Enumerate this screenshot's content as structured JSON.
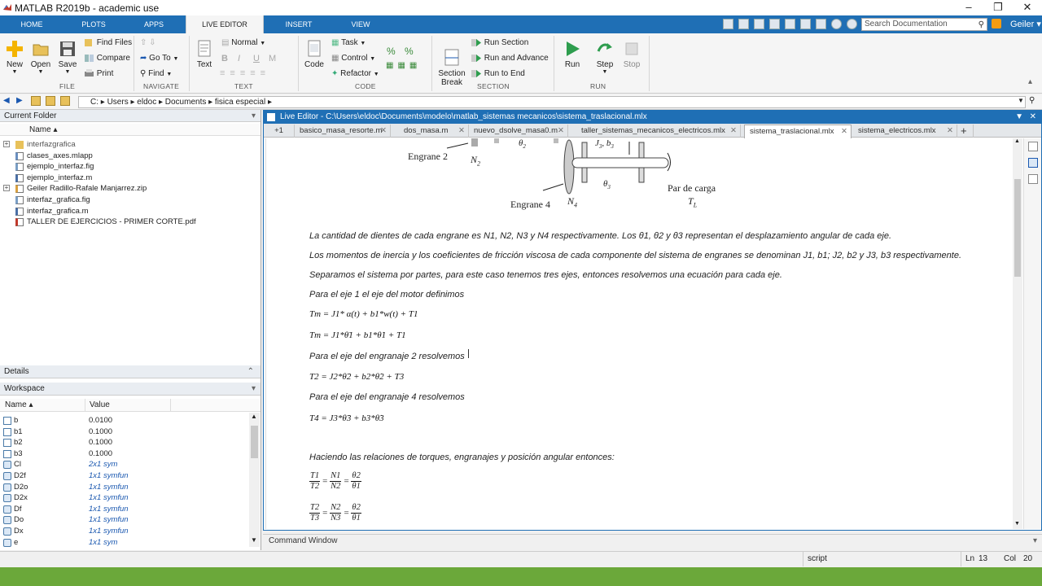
{
  "window": {
    "title": "MATLAB R2019b - academic use",
    "buttons": [
      "–",
      "❐",
      "✕"
    ]
  },
  "ribbon_tabs": [
    {
      "label": "HOME",
      "active": false
    },
    {
      "label": "PLOTS",
      "active": false
    },
    {
      "label": "APPS",
      "active": false
    },
    {
      "label": "LIVE EDITOR",
      "active": true
    },
    {
      "label": "INSERT",
      "active": false
    },
    {
      "label": "VIEW",
      "active": false
    }
  ],
  "search": {
    "placeholder": "Search Documentation"
  },
  "user": {
    "name": "Geiler ▾"
  },
  "ribbon": {
    "file": {
      "new": "New",
      "open": "Open",
      "save": "Save",
      "find_files": "Find Files",
      "compare": "Compare",
      "print": "Print",
      "group": "FILE"
    },
    "navigate": {
      "goto": "Go To",
      "find": "Find",
      "group": "NAVIGATE"
    },
    "text": {
      "text_btn": "Text",
      "style": "Normal",
      "bold": "B",
      "italic": "I",
      "underline": "U",
      "mono": "M",
      "group": "TEXT"
    },
    "code": {
      "code_btn": "Code",
      "task": "Task",
      "control": "Control",
      "refactor": "Refactor",
      "group": "CODE"
    },
    "section": {
      "section_break": "Section\nBreak",
      "run_section": "Run Section",
      "run_advance": "Run and Advance",
      "run_end": "Run to End",
      "group": "SECTION"
    },
    "run": {
      "run": "Run",
      "step": "Step",
      "stop": "Stop",
      "group": "RUN"
    }
  },
  "address": {
    "path": [
      "C:",
      "Users",
      "eldoc",
      "Documents",
      "fisica especial"
    ]
  },
  "current_folder": {
    "title": "Current Folder",
    "column": "Name ▴",
    "items": [
      {
        "name": "interfazgrafica",
        "type": "folder",
        "expand": true
      },
      {
        "name": "clases_axes.mlapp",
        "type": "mlapp"
      },
      {
        "name": "ejemplo_interfaz.fig",
        "type": "fig"
      },
      {
        "name": "ejemplo_interfaz.m",
        "type": "m"
      },
      {
        "name": "Geiler Radillo-Rafale Manjarrez.zip",
        "type": "zip",
        "expand": true
      },
      {
        "name": "interfaz_grafica.fig",
        "type": "fig"
      },
      {
        "name": "interfaz_grafica.m",
        "type": "m"
      },
      {
        "name": "TALLER DE EJERCICIOS - PRIMER CORTE.pdf",
        "type": "pdf"
      }
    ]
  },
  "details": {
    "title": "Details"
  },
  "workspace": {
    "title": "Workspace",
    "col_name": "Name ▴",
    "col_value": "Value",
    "rows": [
      {
        "name": "b",
        "value": "0.0100",
        "sym": false
      },
      {
        "name": "b1",
        "value": "0.1000",
        "sym": false
      },
      {
        "name": "b2",
        "value": "0.1000",
        "sym": false
      },
      {
        "name": "b3",
        "value": "0.1000",
        "sym": false
      },
      {
        "name": "Cl",
        "value": "2x1 sym",
        "sym": true
      },
      {
        "name": "D2f",
        "value": "1x1 symfun",
        "sym": true
      },
      {
        "name": "D2o",
        "value": "1x1 symfun",
        "sym": true
      },
      {
        "name": "D2x",
        "value": "1x1 symfun",
        "sym": true
      },
      {
        "name": "Df",
        "value": "1x1 symfun",
        "sym": true
      },
      {
        "name": "Do",
        "value": "1x1 symfun",
        "sym": true
      },
      {
        "name": "Dx",
        "value": "1x1 symfun",
        "sym": true
      },
      {
        "name": "e",
        "value": "1x1 sym",
        "sym": true
      }
    ]
  },
  "editor": {
    "title": "Live Editor - C:\\Users\\eldoc\\Documents\\modelo\\matlab_sistemas mecanicos\\sistema_traslacional.mlx",
    "nav": "+1",
    "tabs": [
      {
        "label": "basico_masa_resorte.m",
        "active": false
      },
      {
        "label": "dos_masa.m",
        "active": false
      },
      {
        "label": "nuevo_dsolve_masa0.m",
        "active": false
      },
      {
        "label": "taller_sistemas_mecanicos_electricos.mlx",
        "active": false
      },
      {
        "label": "sistema_traslacional.mlx",
        "active": true
      },
      {
        "label": "sistema_electricos.mlx",
        "active": false
      }
    ],
    "figure": {
      "engrane2": "Engrane 2",
      "n2": "N",
      "n2sub": "2",
      "theta2": "θ",
      "theta2sub": "2",
      "j3b3": "J",
      "j3sub": "3",
      "b3": "b",
      "b3sub": "3",
      "theta3": "θ",
      "theta3sub": "3",
      "engrane4": "Engrane 4",
      "n4": "N",
      "n4sub": "4",
      "par": "Par de carga",
      "tl": "T",
      "tlsub": "L"
    },
    "paragraphs": {
      "p1": "La cantidad de dientes de cada engrane es N1, N2, N3 y N4 respectivamente. Los θ1, θ2 y θ3 representan el desplazamiento angular de cada eje.",
      "p2": "Los momentos de inercia y los coeficientes de fricción viscosa de cada componente del sistema de engranes se denominan J1, b1; J2, b2 y J3, b3 respectivamente.",
      "p3": "Separamos el sistema por partes, para este caso tenemos tres ejes, entonces resolvemos una ecuación para cada eje.",
      "p4": "Para el eje 1 el eje del motor definimos",
      "p5": "Para el eje del engranaje 2 resolvemos",
      "p6": "Para el eje del engranaje 4 resolvemos",
      "p7": "Haciendo las relaciones de torques, engranajes y posición angular entonces:"
    },
    "equations": {
      "e1": "Tm = J1* α(t) + b1*w(t) + T1",
      "e2": "Tm = J1*θ̈1 + b1*θ̇1 + T1",
      "e3": "T2 = J2*θ̈2 + b2*θ̇2 + T3",
      "e4": "T4 = J3*θ̈3 + b3*θ̇3",
      "f1": [
        "T1",
        "T2",
        "N1",
        "N2",
        "θ2",
        "θ1"
      ],
      "f2": [
        "T2",
        "T3",
        "N2",
        "N3",
        "θ2",
        "θ1"
      ]
    }
  },
  "command_window": {
    "title": "Command Window"
  },
  "status": {
    "mode": "script",
    "ln_label": "Ln",
    "ln": "13",
    "col_label": "Col",
    "col": "20"
  }
}
